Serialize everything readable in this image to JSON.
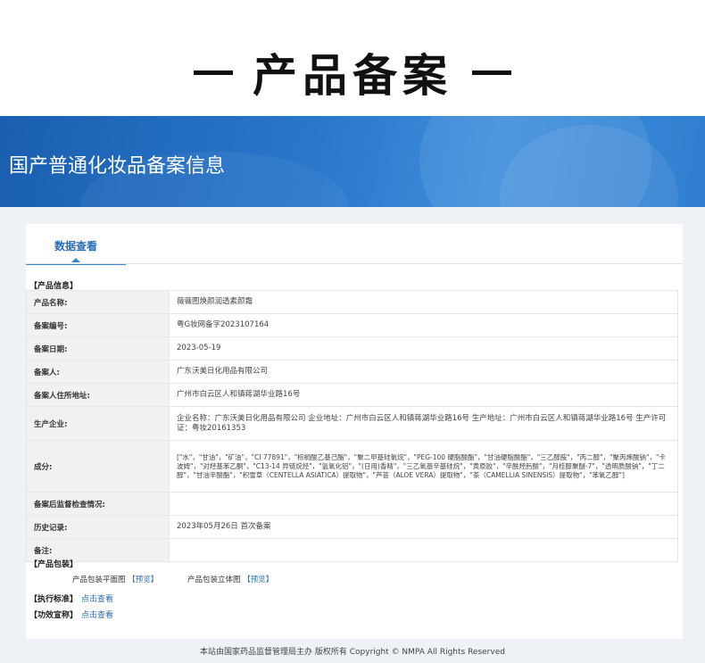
{
  "hero_title": "产品备案",
  "banner_title": "国产普通化妆品备案信息",
  "tab_label": "数据查看",
  "product_info_label": "【产品信息】",
  "rows": [
    {
      "label": "产品名称:",
      "value": "薇薇图焕颜润透素颜霜"
    },
    {
      "label": "备案编号:",
      "value": "粤G妆网备字2023107164"
    },
    {
      "label": "备案日期:",
      "value": "2023-05-19"
    },
    {
      "label": "备案人:",
      "value": "广东沃美日化用品有限公司"
    },
    {
      "label": "备案人住所地址:",
      "value": "广州市白云区人和镇蒋湖华业路16号"
    },
    {
      "label": "生产企业:",
      "value": "企业名称：广东沃美日化用品有限公司 企业地址：广州市白云区人和镇蒋湖华业路16号 生产地址：广州市白云区人和镇蒋湖华业路16号 生产许可证：粤妆20161353"
    },
    {
      "label": "成分:",
      "value": "[\"水\"，\"甘油\"，\"矿油\"，\"CI 77891\"，\"棕榈酸乙基己酯\"，\"聚二甲基硅氧烷\"，\"PEG-100 硬脂酸酯\"，\"甘油硬脂酸酯\"，\"三乙醇胺\"，\"丙二醇\"，\"聚丙烯酸钠\"，\"卡波姆\"，\"对羟基苯乙酮\"，\"C13-14 异链烷烃\"，\"氢氧化铝\"，\"(日用)香精\"，\"三乙氧基辛基硅烷\"，\"黄原胶\"，\"辛酰羟肟酸\"，\"月桂醇聚醚-7\"，\"透明质酸钠\"，\"丁二醇\"，\"甘油辛酸酯\"，\"积雪草（CENTELLA ASIATICA）提取物\"，\"芦荟（ALOE VERA）提取物\"，\"茶（CAMELLIA SINENSIS）提取物\"，\"苯氧乙醇\"]"
    },
    {
      "label": "备案后监督检查情况:",
      "value": ""
    },
    {
      "label": "历史记录:",
      "value": "2023年05月26日 首次备案"
    },
    {
      "label": "备注:",
      "value": ""
    }
  ],
  "package_label": "【产品包装】",
  "package_flat": {
    "text": "产品包装平面图",
    "link": "【预览】"
  },
  "package_3d": {
    "text": "产品包装立体图",
    "link": "【预览】"
  },
  "standard": {
    "label": "【执行标准】",
    "link": "点击查看"
  },
  "efficacy": {
    "label": "【功效宣称】",
    "link": "点击查看"
  },
  "footer": "本站由国家药品监督管理局主办 版权所有 Copyright © NMPA All Rights Reserved"
}
